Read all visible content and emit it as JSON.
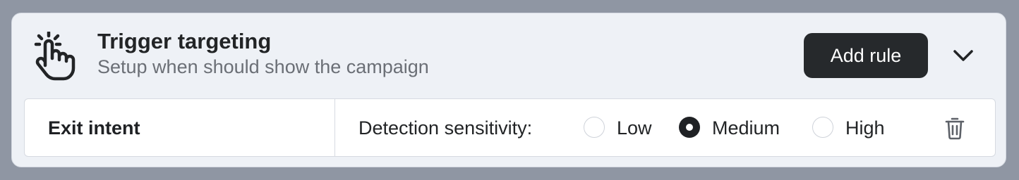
{
  "header": {
    "title": "Trigger targeting",
    "subtitle": "Setup when should show the campaign",
    "add_rule_label": "Add rule",
    "icon": "tap-hand-icon",
    "collapse_icon": "chevron-down-icon"
  },
  "rule": {
    "name": "Exit intent",
    "setting_label": "Detection sensitivity:",
    "options": [
      {
        "label": "Low",
        "selected": false
      },
      {
        "label": "Medium",
        "selected": true
      },
      {
        "label": "High",
        "selected": false
      }
    ],
    "delete_icon": "trash-icon"
  },
  "colors": {
    "page_background": "#8f96a3",
    "card_background": "#eef1f6",
    "button_background": "#26292c",
    "text_primary": "#222426",
    "text_secondary": "#6b6f76"
  }
}
